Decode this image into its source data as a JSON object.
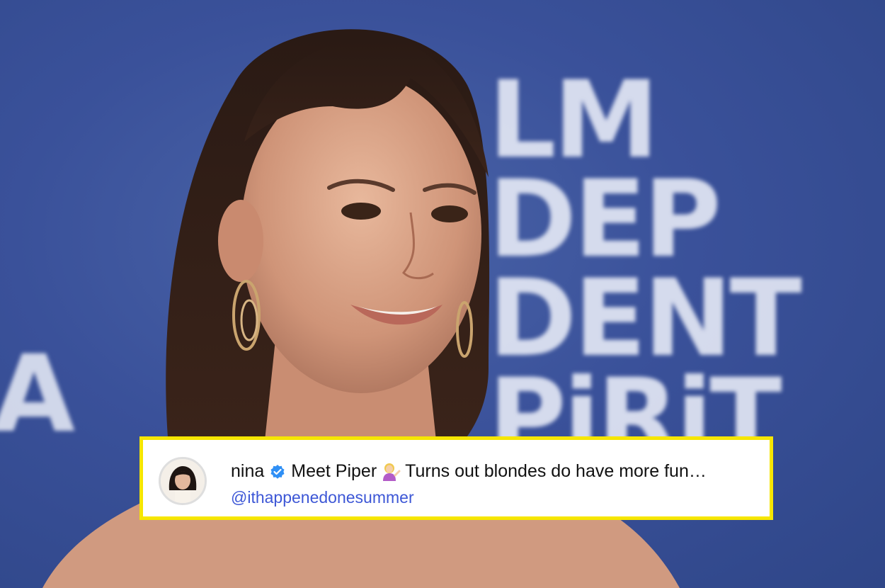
{
  "backdrop": {
    "lines": [
      "LM",
      "DEP",
      "DENT",
      "PiRiT"
    ],
    "left_letter": "A"
  },
  "caption": {
    "username": "nina",
    "text": "Meet Piper",
    "text_after_emoji": "Turns out blondes do have more fun…",
    "handle": "@ithappenedonesummer",
    "emoji_icon": "woman-tipping-hand-emoji",
    "verified_icon": "verified-badge-icon"
  },
  "colors": {
    "backdrop_blue": "#3a519a",
    "card_border": "#f6e600",
    "handle_link": "#3d57d6",
    "verified_badge": "#2f8ff5"
  }
}
